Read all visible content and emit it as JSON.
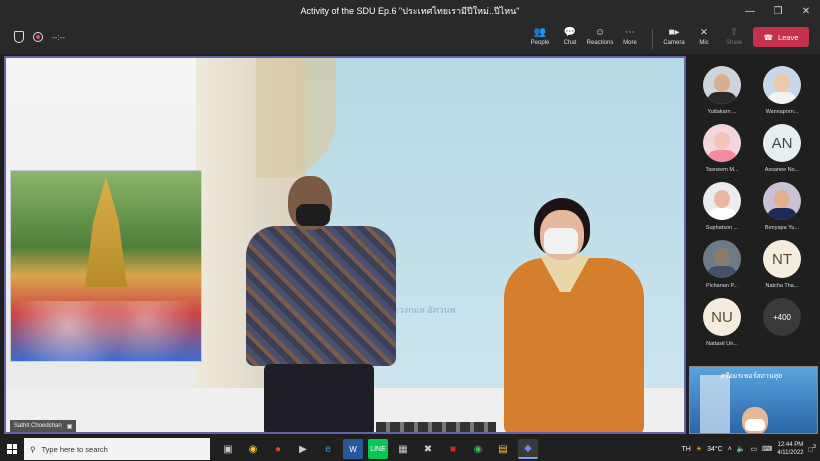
{
  "window": {
    "title": "Activity of the SDU Ep.6 \"ประเทศไทยเรามีปีใหม่..ปีไหน\"",
    "controls": [
      "minimize",
      "maximize",
      "close"
    ]
  },
  "toolbar": {
    "timer": "--:--",
    "buttons": [
      {
        "label": "People",
        "icon": "people-icon"
      },
      {
        "label": "Chat",
        "icon": "chat-icon"
      },
      {
        "label": "Reactions",
        "icon": "reactions-icon"
      },
      {
        "label": "More",
        "icon": "more-icon"
      },
      {
        "label": "Camera",
        "icon": "camera-icon"
      },
      {
        "label": "Mic",
        "icon": "mic-off-icon"
      },
      {
        "label": "Share",
        "icon": "share-icon"
      }
    ],
    "leave_label": "Leave",
    "leave_color": "#c4314b"
  },
  "stage": {
    "speaker_name": "Sathit Choedchan",
    "watermark": "ผศ.ดร.ดวงกมล อัศวนพ"
  },
  "gallery": [
    {
      "name": "Yuttakarn ...",
      "type": "photo",
      "skin": "#d9b08f",
      "shirt": "#2a2a2a"
    },
    {
      "name": "Wannaporn...",
      "type": "photo",
      "skin": "#f0c8a8",
      "shirt": "#f2f2f2"
    },
    {
      "name": "Tasneem M...",
      "type": "photo",
      "skin": "#f3c5b6",
      "shirt": "#f48ca0"
    },
    {
      "name": "Assanee No...",
      "type": "initials",
      "initials": "AN"
    },
    {
      "name": "Suphatson ...",
      "type": "photo",
      "skin": "#e8b9a0",
      "shirt": "#ffffff"
    },
    {
      "name": "Benyapa Yu...",
      "type": "photo",
      "skin": "#e0b090",
      "shirt": "#1d2a55"
    },
    {
      "name": "Pichanan P...",
      "type": "photo",
      "skin": "#8c7a6a",
      "shirt": "#44506a"
    },
    {
      "name": "Natcha Tha...",
      "type": "initials",
      "initials": "NT"
    },
    {
      "name": "Nattasit Un...",
      "type": "initials",
      "initials": "NU"
    },
    {
      "name": "",
      "type": "more",
      "initials": "+400"
    }
  ],
  "self_view": {
    "banner": "ศรีอมรเซอร์สถานทุ่ย"
  },
  "taskbar": {
    "search_placeholder": "Type here to search",
    "apps": [
      "task-view-icon",
      "chrome-icon",
      "powerpoint-icon",
      "media-player-icon",
      "edge-icon",
      "word-icon",
      "line-icon",
      "calculator-icon",
      "xbox-icon",
      "game-icon",
      "chrome-alt-icon",
      "file-explorer-icon",
      "teams-icon"
    ],
    "language": "TH",
    "weather": "34°C",
    "time": "12:44 PM",
    "date": "4/11/2022",
    "notification_count": "3"
  }
}
